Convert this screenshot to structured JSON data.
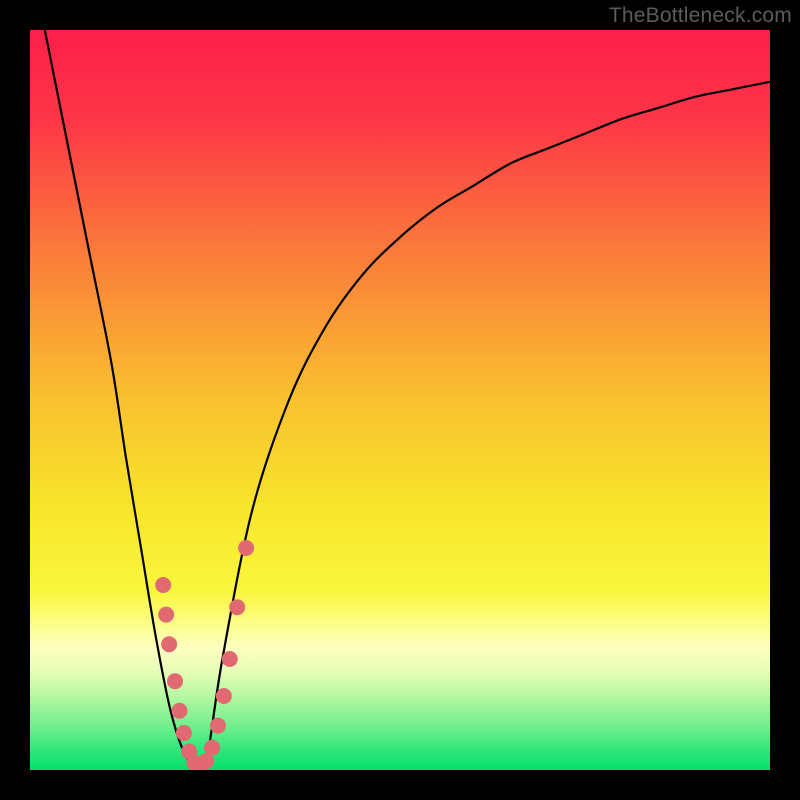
{
  "attribution": "TheBottleneck.com",
  "chart_data": {
    "type": "line",
    "title": "",
    "xlabel": "",
    "ylabel": "",
    "xlim": [
      0,
      100
    ],
    "ylim": [
      0,
      100
    ],
    "series": [
      {
        "name": "bottleneck-curve",
        "x": [
          2,
          5,
          8,
          11,
          13,
          15,
          17,
          19,
          21,
          23,
          24,
          26,
          30,
          35,
          40,
          45,
          50,
          55,
          60,
          65,
          70,
          75,
          80,
          85,
          90,
          95,
          100
        ],
        "values": [
          100,
          85,
          70,
          55,
          42,
          30,
          18,
          8,
          2,
          0,
          2,
          15,
          35,
          50,
          60,
          67,
          72,
          76,
          79,
          82,
          84,
          86,
          88,
          89.5,
          91,
          92,
          93
        ]
      }
    ],
    "markers": {
      "name": "highlighted-points",
      "color": "#e16a72",
      "points": [
        {
          "x": 18.0,
          "y": 25
        },
        {
          "x": 18.4,
          "y": 21
        },
        {
          "x": 18.8,
          "y": 17
        },
        {
          "x": 19.6,
          "y": 12
        },
        {
          "x": 20.2,
          "y": 8
        },
        {
          "x": 20.8,
          "y": 5
        },
        {
          "x": 21.5,
          "y": 2.5
        },
        {
          "x": 22.2,
          "y": 1
        },
        {
          "x": 23.0,
          "y": 0.5
        },
        {
          "x": 23.8,
          "y": 1.2
        },
        {
          "x": 24.6,
          "y": 3
        },
        {
          "x": 25.4,
          "y": 6
        },
        {
          "x": 26.2,
          "y": 10
        },
        {
          "x": 27.0,
          "y": 15
        },
        {
          "x": 28.0,
          "y": 22
        },
        {
          "x": 29.2,
          "y": 30
        }
      ]
    },
    "gradient_stops": [
      {
        "offset": 0.0,
        "color": "#fd1f4a"
      },
      {
        "offset": 0.12,
        "color": "#fd3647"
      },
      {
        "offset": 0.3,
        "color": "#fb7b3a"
      },
      {
        "offset": 0.5,
        "color": "#f9c12f"
      },
      {
        "offset": 0.65,
        "color": "#f8e62b"
      },
      {
        "offset": 0.76,
        "color": "#f9f63e"
      },
      {
        "offset": 0.8,
        "color": "#fcfd85"
      },
      {
        "offset": 0.835,
        "color": "#feffc0"
      },
      {
        "offset": 0.865,
        "color": "#e8fdb8"
      },
      {
        "offset": 0.9,
        "color": "#b6f8a3"
      },
      {
        "offset": 0.94,
        "color": "#72ef8d"
      },
      {
        "offset": 0.975,
        "color": "#2de578"
      },
      {
        "offset": 1.0,
        "color": "#02df6c"
      }
    ]
  }
}
